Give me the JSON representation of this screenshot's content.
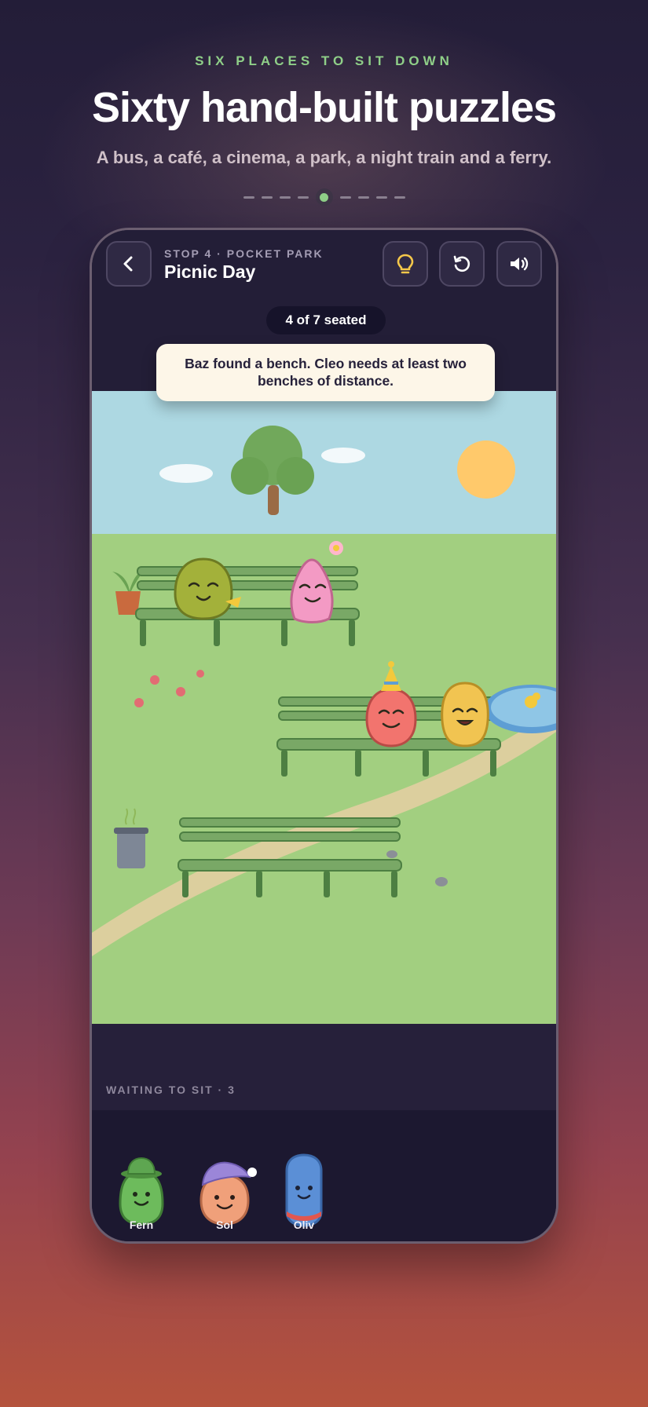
{
  "header": {
    "eyebrow": "SIX PLACES TO SIT DOWN",
    "headline": "Sixty hand-built puzzles",
    "subline": "A bus, a café, a cinema, a park, a night train and a ferry.",
    "page_indicator": {
      "total": 10,
      "active_index": 4
    }
  },
  "game": {
    "stop_label": "STOP 4 · POCKET PARK",
    "level_title": "Picnic Day",
    "seated_status": "4 of 7 seated",
    "hint_message": "Baz found a bench. Cleo needs at least two benches of distance.",
    "buttons": {
      "back": "chevron-left-icon",
      "hint": "lightbulb-icon",
      "restart": "restart-icon",
      "sound": "speaker-icon"
    },
    "waiting_label": "WAITING TO SIT · 3",
    "waiting_characters": [
      {
        "name": "Fern",
        "color": "#6dbb5c"
      },
      {
        "name": "Sol",
        "color": "#f0a07a"
      },
      {
        "name": "Oliv",
        "color": "#5b8fd6"
      }
    ],
    "seated_characters": [
      {
        "color": "#a3b13a"
      },
      {
        "color": "#f39ac4"
      },
      {
        "color": "#f2746e"
      },
      {
        "color": "#f1c451"
      }
    ]
  },
  "colors": {
    "accent_green": "#8fcf88",
    "hint_bg": "#fdf6e8",
    "grass": "#a2cf80",
    "sky": "#add8e2",
    "sun": "#ffc96b",
    "bench": "#79a866"
  }
}
